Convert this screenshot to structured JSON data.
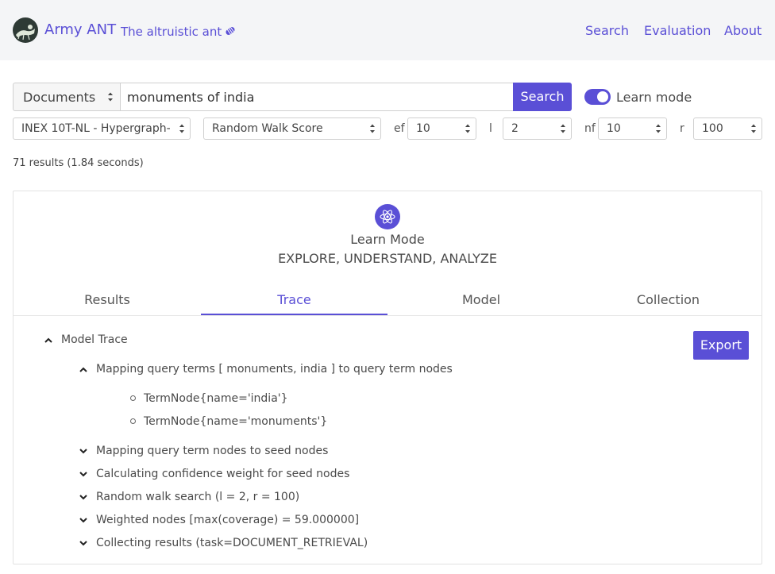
{
  "brand": {
    "title": "Army ANT",
    "tagline": "The altruistic ant",
    "logo_icon": "ant-logo-icon",
    "badge_icon": "tag-icon"
  },
  "nav": {
    "links": [
      "Search",
      "Evaluation",
      "About"
    ]
  },
  "search": {
    "type_value": "Documents",
    "query": "monuments of india",
    "button_label": "Search",
    "learn_mode_label": "Learn mode",
    "learn_mode_on": true
  },
  "params": {
    "index_value": "INEX 10T-NL - Hypergraph-",
    "ranking_value": "Random Walk Score",
    "ef_label": "ef",
    "ef_value": "10",
    "l_label": "l",
    "l_value": "2",
    "nf_label": "nf",
    "nf_value": "10",
    "r_label": "r",
    "r_value": "100"
  },
  "results_summary": "71 results (1.84 seconds)",
  "learn": {
    "icon": "atom-icon",
    "title": "Learn Mode",
    "subtitle": "EXPLORE, UNDERSTAND, ANALYZE",
    "tabs": [
      "Results",
      "Trace",
      "Model",
      "Collection"
    ],
    "active_tab": "Trace"
  },
  "trace": {
    "export_label": "Export",
    "root": "Model Trace",
    "steps": [
      "Mapping query terms [ monuments, india ] to query term nodes",
      "Mapping query term nodes to seed nodes",
      "Calculating confidence weight for seed nodes",
      "Random walk search (l = 2, r = 100)",
      "Weighted nodes [max(coverage) = 59.000000]",
      "Collecting results (task=DOCUMENT_RETRIEVAL)"
    ],
    "sub_items": [
      "TermNode{name='india'}",
      "TermNode{name='monuments'}"
    ]
  },
  "colors": {
    "accent": "#5a4fd6",
    "navbar_bg": "#f4f5f7"
  }
}
